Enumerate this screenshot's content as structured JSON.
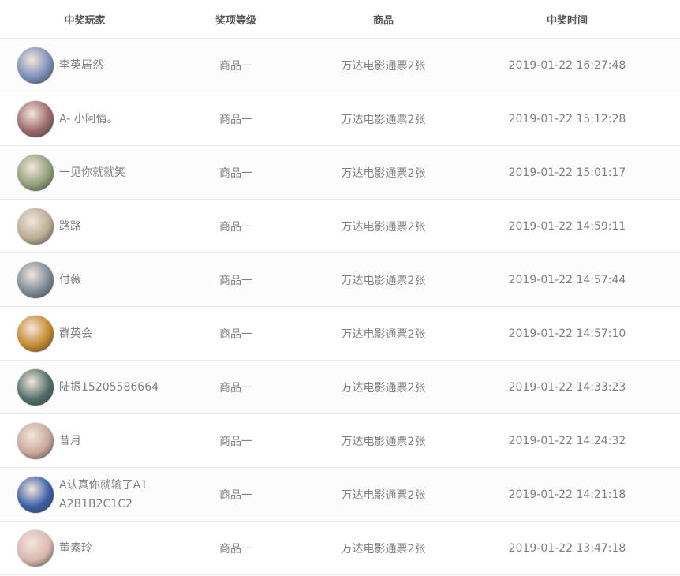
{
  "headers": {
    "player": "中奖玩家",
    "level": "奖项等级",
    "goods": "商品",
    "time": "中奖时间"
  },
  "rows": [
    {
      "name": "李英居然",
      "level": "商品一",
      "goods": "万达电影通票2张",
      "time": "2019-01-22 16:27:48",
      "avatar_color": "#7b8fb8"
    },
    {
      "name": "A- 小阿倩。",
      "level": "商品一",
      "goods": "万达电影通票2张",
      "time": "2019-01-22 15:12:28",
      "avatar_color": "#9a6a6a"
    },
    {
      "name": "一见你就就笑",
      "level": "商品一",
      "goods": "万达电影通票2张",
      "time": "2019-01-22 15:01:17",
      "avatar_color": "#8fa07a"
    },
    {
      "name": "路路",
      "level": "商品一",
      "goods": "万达电影通票2张",
      "time": "2019-01-22 14:59:11",
      "avatar_color": "#b9ad95"
    },
    {
      "name": "付薇",
      "level": "商品一",
      "goods": "万达电影通票2张",
      "time": "2019-01-22 14:57:44",
      "avatar_color": "#7c8a95"
    },
    {
      "name": "群英会",
      "level": "商品一",
      "goods": "万达电影通票2张",
      "time": "2019-01-22 14:57:10",
      "avatar_color": "#c48a2c"
    },
    {
      "name": "陆振15205586664",
      "level": "商品一",
      "goods": "万达电影通票2张",
      "time": "2019-01-22 14:33:23",
      "avatar_color": "#4f6e6a"
    },
    {
      "name": "昔月",
      "level": "商品一",
      "goods": "万达电影通票2张",
      "time": "2019-01-22 14:24:32",
      "avatar_color": "#c9a89a"
    },
    {
      "name": "A认真你就输了A1A2B1B2C1C2",
      "level": "商品一",
      "goods": "万达电影通票2张",
      "time": "2019-01-22 14:21:18",
      "avatar_color": "#3a5fa8"
    },
    {
      "name": "董素玲",
      "level": "商品一",
      "goods": "万达电影通票2张",
      "time": "2019-01-22 13:47:18",
      "avatar_color": "#d8b8b0"
    }
  ]
}
